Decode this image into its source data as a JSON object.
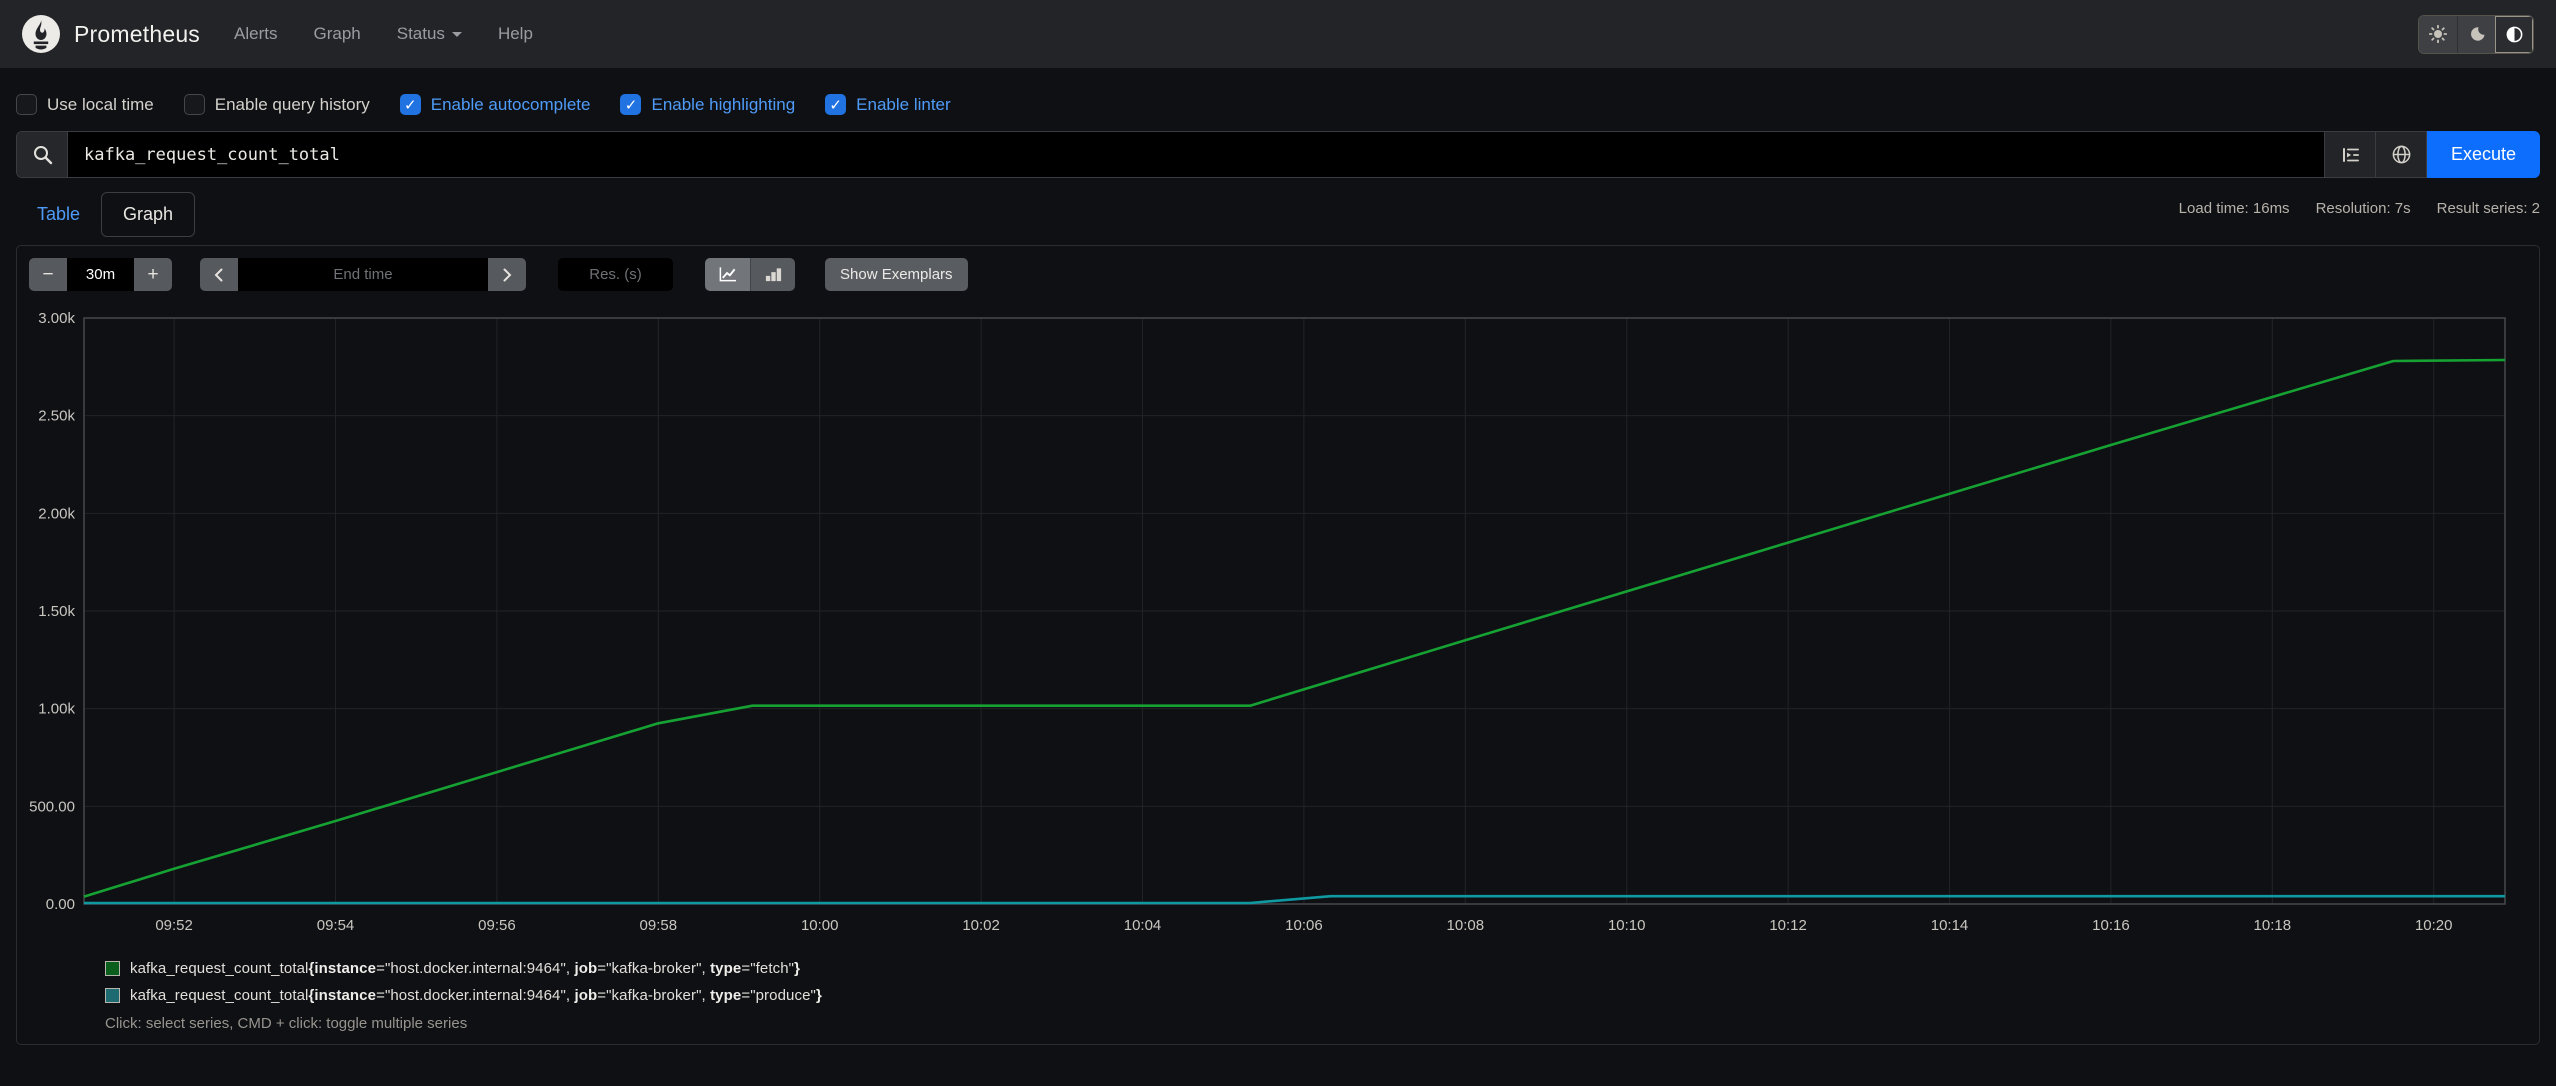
{
  "navbar": {
    "brand": "Prometheus",
    "items": [
      {
        "label": "Alerts",
        "caret": false
      },
      {
        "label": "Graph",
        "caret": false
      },
      {
        "label": "Status",
        "caret": true
      },
      {
        "label": "Help",
        "caret": false
      }
    ],
    "theme_buttons": [
      "sun-icon",
      "moon-icon",
      "circle-half-icon"
    ]
  },
  "options": {
    "items": [
      {
        "label": "Use local time",
        "checked": false
      },
      {
        "label": "Enable query history",
        "checked": false
      },
      {
        "label": "Enable autocomplete",
        "checked": true
      },
      {
        "label": "Enable highlighting",
        "checked": true
      },
      {
        "label": "Enable linter",
        "checked": true
      }
    ]
  },
  "query": {
    "value": "kafka_request_count_total",
    "execute_label": "Execute"
  },
  "stats": {
    "load_time": "Load time: 16ms",
    "resolution": "Resolution: 7s",
    "result_series": "Result series: 2"
  },
  "tabs": {
    "table": "Table",
    "graph": "Graph",
    "active": "Graph"
  },
  "controls": {
    "range": "30m",
    "minus": "−",
    "plus": "+",
    "end_time_placeholder": "End time",
    "res_placeholder": "Res. (s)",
    "show_exemplars": "Show Exemplars"
  },
  "chart_data": {
    "type": "line",
    "title": "kafka_request_count_total",
    "x_domain": [
      "09:50:53",
      "10:20:53"
    ],
    "ylim": [
      0,
      3000
    ],
    "grid": true,
    "legend_position": "bottom",
    "y_ticks": [
      {
        "v": 0,
        "label": "0.00"
      },
      {
        "v": 500,
        "label": "500.00"
      },
      {
        "v": 1000,
        "label": "1.00k"
      },
      {
        "v": 1500,
        "label": "1.50k"
      },
      {
        "v": 2000,
        "label": "2.00k"
      },
      {
        "v": 2500,
        "label": "2.50k"
      },
      {
        "v": 3000,
        "label": "3.00k"
      }
    ],
    "x_ticks": [
      "09:52",
      "09:54",
      "09:56",
      "09:58",
      "10:00",
      "10:02",
      "10:04",
      "10:06",
      "10:08",
      "10:10",
      "10:12",
      "10:14",
      "10:16",
      "10:18",
      "10:20"
    ],
    "series": [
      {
        "name": "kafka_request_count_total{instance=\"host.docker.internal:9464\", job=\"kafka-broker\", type=\"fetch\"}",
        "color": "#16a233",
        "points": [
          [
            "09:50:53",
            38
          ],
          [
            "09:52:00",
            180
          ],
          [
            "09:54:00",
            425
          ],
          [
            "09:56:00",
            675
          ],
          [
            "09:58:00",
            925
          ],
          [
            "09:59:10",
            1015
          ],
          [
            "10:05:20",
            1015
          ],
          [
            "10:08:00",
            1350
          ],
          [
            "10:12:00",
            1850
          ],
          [
            "10:16:00",
            2350
          ],
          [
            "10:19:30",
            2780
          ],
          [
            "10:20:53",
            2785
          ]
        ]
      },
      {
        "name": "kafka_request_count_total{instance=\"host.docker.internal:9464\", job=\"kafka-broker\", type=\"produce\"}",
        "color": "#0f9aa2",
        "points": [
          [
            "09:50:53",
            5
          ],
          [
            "10:05:20",
            5
          ],
          [
            "10:06:20",
            40
          ],
          [
            "10:20:53",
            40
          ]
        ]
      }
    ]
  },
  "legend": {
    "series": [
      {
        "metric": "kafka_request_count_total",
        "color": "#16a233",
        "swatch_fill": "#0b5f1c",
        "labels": [
          {
            "key": "instance",
            "value": "host.docker.internal:9464"
          },
          {
            "key": "job",
            "value": "kafka-broker"
          },
          {
            "key": "type",
            "value": "fetch"
          }
        ]
      },
      {
        "metric": "kafka_request_count_total",
        "color": "#0f9aa2",
        "swatch_fill": "#1d6a70",
        "labels": [
          {
            "key": "instance",
            "value": "host.docker.internal:9464"
          },
          {
            "key": "job",
            "value": "kafka-broker"
          },
          {
            "key": "type",
            "value": "produce"
          }
        ]
      }
    ],
    "hint": "Click: select series, CMD + click: toggle multiple series"
  },
  "colors": {
    "page_bg": "#0f1014",
    "navbar_bg": "#232428",
    "accent_blue": "#0d6efd",
    "link_blue": "#4f9cf8",
    "grid_line": "#222327",
    "plot_border": "#47484c",
    "tick_text": "#c9c6c0"
  }
}
